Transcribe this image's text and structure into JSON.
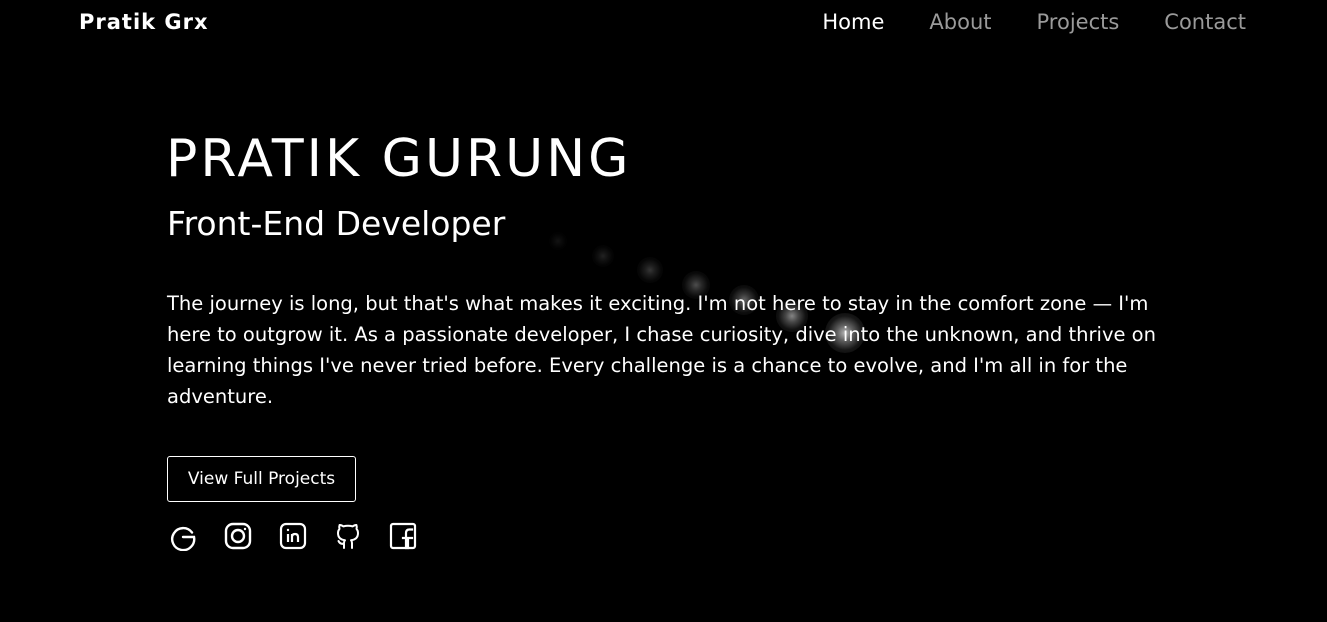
{
  "header": {
    "brand": "Pratik Grx",
    "nav": [
      {
        "label": "Home",
        "active": true
      },
      {
        "label": "About",
        "active": false
      },
      {
        "label": "Projects",
        "active": false
      },
      {
        "label": "Contact",
        "active": false
      }
    ]
  },
  "hero": {
    "name": "PRATIK GURUNG",
    "role": "Front-End Developer",
    "bio": "The journey is long, but that's what makes it exciting. I'm not here to stay in the comfort zone — I'm here to outgrow it. As a passionate developer, I chase curiosity, dive into the unknown, and thrive on learning things I've never tried before. Every challenge is a chance to evolve, and I'm all in for the adventure.",
    "cta_label": "View Full Projects"
  },
  "socials": [
    {
      "icon": "google-icon"
    },
    {
      "icon": "instagram-icon"
    },
    {
      "icon": "linkedin-icon"
    },
    {
      "icon": "github-icon"
    },
    {
      "icon": "facebook-icon"
    }
  ],
  "colors": {
    "background": "#000000",
    "text": "#ffffff",
    "nav_inactive": "#9a9a9a"
  }
}
